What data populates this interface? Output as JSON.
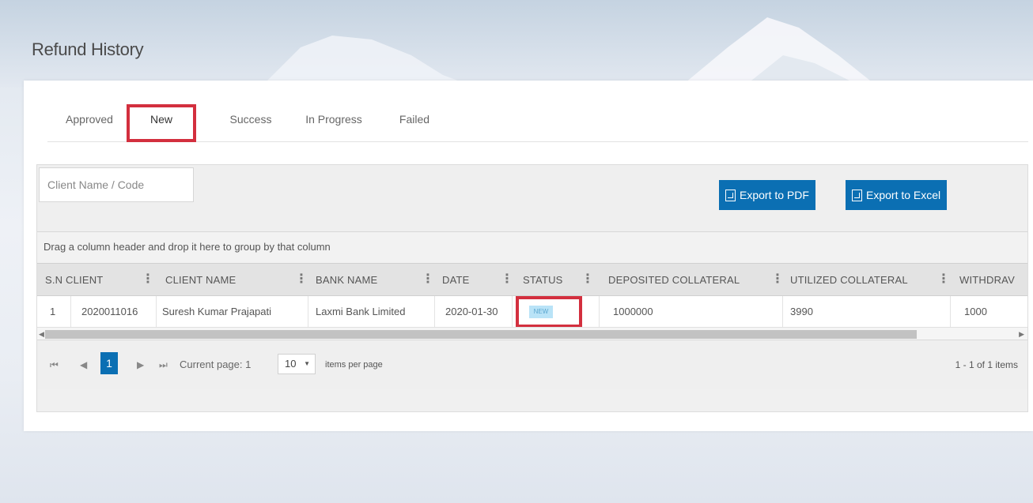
{
  "page": {
    "title": "Refund History"
  },
  "tabs": [
    {
      "label": "Approved"
    },
    {
      "label": "New"
    },
    {
      "label": "Success"
    },
    {
      "label": "In Progress"
    },
    {
      "label": "Failed"
    }
  ],
  "active_tab": "New",
  "toolbar": {
    "search_placeholder": "Client Name / Code",
    "export_pdf_label": "Export to PDF",
    "export_excel_label": "Export to Excel"
  },
  "grid": {
    "group_hint": "Drag a column header and drop it here to group by that column",
    "columns": [
      "S.N",
      "CLIENT",
      "CLIENT NAME",
      "BANK NAME",
      "DATE",
      "STATUS",
      "DEPOSITED COLLATERAL",
      "UTILIZED COLLATERAL",
      "WITHDRAV"
    ],
    "rows": [
      {
        "sn": "1",
        "client": "2020011016",
        "client_name": "Suresh Kumar Prajapati",
        "bank_name": "Laxmi Bank Limited",
        "date": "2020-01-30",
        "status": "NEW",
        "deposited_collateral": "1000000",
        "utilized_collateral": "3990",
        "withdraw": "1000"
      }
    ]
  },
  "pager": {
    "current_page": "1",
    "current_page_text": "Current page: 1",
    "page_size": "10",
    "items_per_page_label": "items per page",
    "summary": "1 - 1 of 1 items"
  },
  "colors": {
    "accent": "#0b6fb3",
    "highlight_border": "#d32f3e",
    "status_badge_bg": "#b9e3f7"
  }
}
